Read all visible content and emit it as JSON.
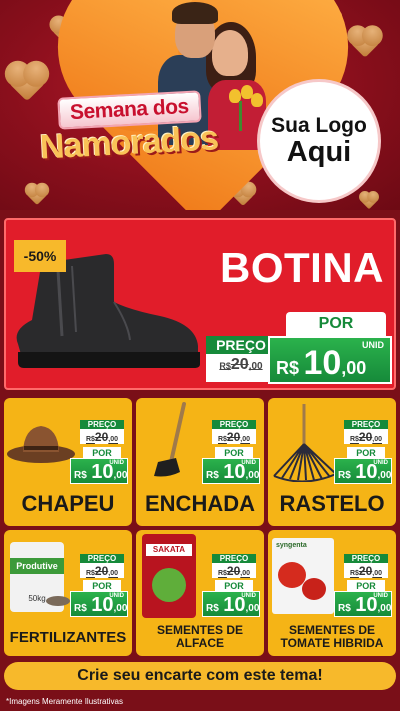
{
  "header": {
    "title_line1": "Semana dos",
    "title_line2": "Namorados",
    "logo_line1": "Sua Logo",
    "logo_line2": "Aqui"
  },
  "main_product": {
    "discount": "-50%",
    "name": "BOTINA",
    "preco_label": "PREÇO",
    "old_currency": "R$",
    "old_int": "20",
    "old_dec": ",00",
    "por_label": "POR",
    "unid_label": "UNID",
    "new_currency": "R$",
    "new_int": "10",
    "new_dec": ",00"
  },
  "products": [
    {
      "name": "CHAPEU",
      "preco_label": "PREÇO",
      "old_currency": "R$",
      "old_int": "20",
      "old_dec": ",00",
      "por_label": "POR",
      "unid_label": "UNID",
      "new_currency": "R$",
      "new_int": "10",
      "new_dec": ",00"
    },
    {
      "name": "ENCHADA",
      "preco_label": "PREÇO",
      "old_currency": "R$",
      "old_int": "20",
      "old_dec": ",00",
      "por_label": "POR",
      "unid_label": "UNID",
      "new_currency": "R$",
      "new_int": "10",
      "new_dec": ",00"
    },
    {
      "name": "RASTELO",
      "preco_label": "PREÇO",
      "old_currency": "R$",
      "old_int": "20",
      "old_dec": ",00",
      "por_label": "POR",
      "unid_label": "UNID",
      "new_currency": "R$",
      "new_int": "10",
      "new_dec": ",00"
    },
    {
      "name": "FERTILIZANTES",
      "preco_label": "PREÇO",
      "old_currency": "R$",
      "old_int": "20",
      "old_dec": ",00",
      "por_label": "POR",
      "unid_label": "UNID",
      "new_currency": "R$",
      "new_int": "10",
      "new_dec": ",00",
      "package_text": "Produtive",
      "package_weight": "50kg"
    },
    {
      "name_line1": "SEMENTES DE",
      "name_line2": "ALFACE",
      "preco_label": "PREÇO",
      "old_currency": "R$",
      "old_int": "20",
      "old_dec": ",00",
      "por_label": "POR",
      "unid_label": "UNID",
      "new_currency": "R$",
      "new_int": "10",
      "new_dec": ",00",
      "package_text": "SAKATA"
    },
    {
      "name_line1": "SEMENTES DE",
      "name_line2": "TOMATE HIBRIDA",
      "preco_label": "PREÇO",
      "old_currency": "R$",
      "old_int": "20",
      "old_dec": ",00",
      "por_label": "POR",
      "unid_label": "UNID",
      "new_currency": "R$",
      "new_int": "10",
      "new_dec": ",00",
      "package_text": "syngenta"
    }
  ],
  "footer": {
    "cta": "Crie seu encarte com este tema!",
    "disclaimer": "*Imagens Meramente Ilustrativas"
  },
  "colors": {
    "background": "#7a0f18",
    "panel_red": "#e11d2a",
    "card_yellow": "#f5b416",
    "price_green": "#168a3a",
    "title_gold": "#f9c257"
  }
}
